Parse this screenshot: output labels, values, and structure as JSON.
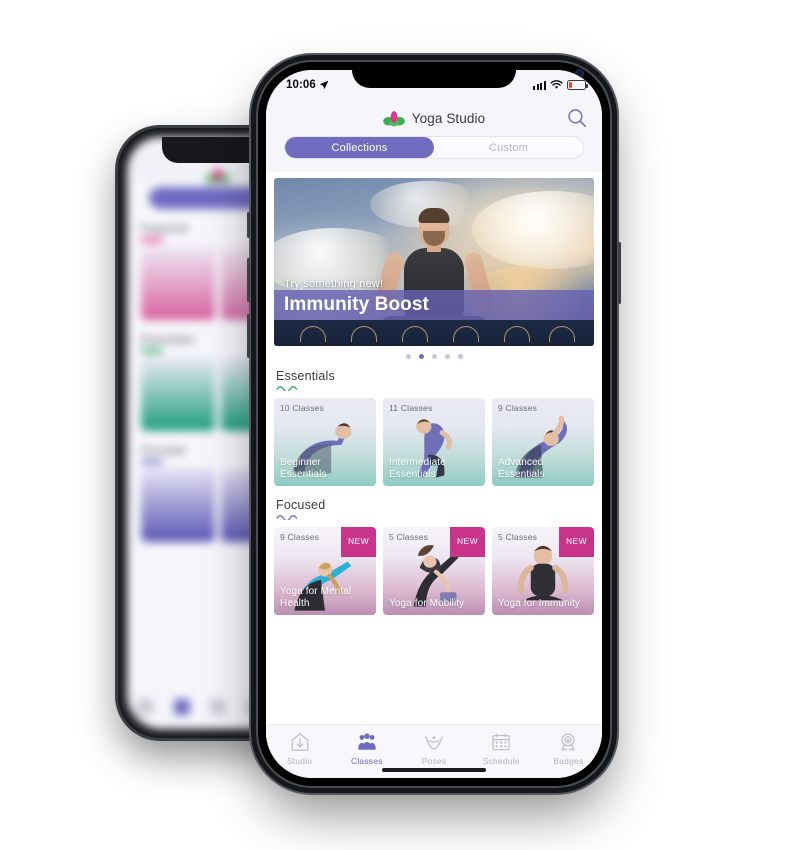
{
  "app": {
    "title": "Yoga Studio",
    "logo_icon": "lotus-icon",
    "search_icon": "search-icon",
    "accent": "#6f6bc4",
    "badge_color": "#c9338a"
  },
  "status_bar": {
    "time": "10:06",
    "location_icon": "location-arrow-icon",
    "signal_icon": "cellular-signal-icon",
    "wifi_icon": "wifi-icon",
    "battery_icon": "battery-low-icon"
  },
  "segmented": {
    "items": [
      {
        "label": "Collections",
        "active": true
      },
      {
        "label": "Custom",
        "active": false
      }
    ]
  },
  "hero": {
    "eyebrow": "Try something new!",
    "title": "Immunity Boost",
    "dots_total": 5,
    "dots_active_index": 1
  },
  "sections": [
    {
      "title": "Essentials",
      "underline_color": "#2fa868",
      "style": "ess",
      "cards": [
        {
          "count": "10 Classes",
          "name": "Beginner Essentials",
          "new": false
        },
        {
          "count": "11 Classes",
          "name": "Intermediate Essentials",
          "new": false
        },
        {
          "count": "9 Classes",
          "name": "Advanced Essentials",
          "new": false
        }
      ]
    },
    {
      "title": "Focused",
      "underline_color": "#6f6bc4",
      "style": "foc",
      "cards": [
        {
          "count": "9 Classes",
          "name": "Yoga for Mental Health",
          "new": true,
          "new_label": "NEW"
        },
        {
          "count": "5 Classes",
          "name": "Yoga for Mobility",
          "new": true,
          "new_label": "NEW"
        },
        {
          "count": "5 Classes",
          "name": "Yoga for Immunity",
          "new": true,
          "new_label": "NEW"
        }
      ]
    }
  ],
  "tabbar": {
    "items": [
      {
        "label": "Studio",
        "icon": "home-download-icon",
        "active": false
      },
      {
        "label": "Classes",
        "icon": "people-group-icon",
        "active": true
      },
      {
        "label": "Poses",
        "icon": "yoga-pose-icon",
        "active": false
      },
      {
        "label": "Schedule",
        "icon": "calendar-icon",
        "active": false
      },
      {
        "label": "Badges",
        "icon": "award-ribbon-icon",
        "active": false
      }
    ]
  },
  "background_phone": {
    "sections": [
      "Featured",
      "Essentials",
      "Focused"
    ],
    "segmented_active": "Collections"
  }
}
